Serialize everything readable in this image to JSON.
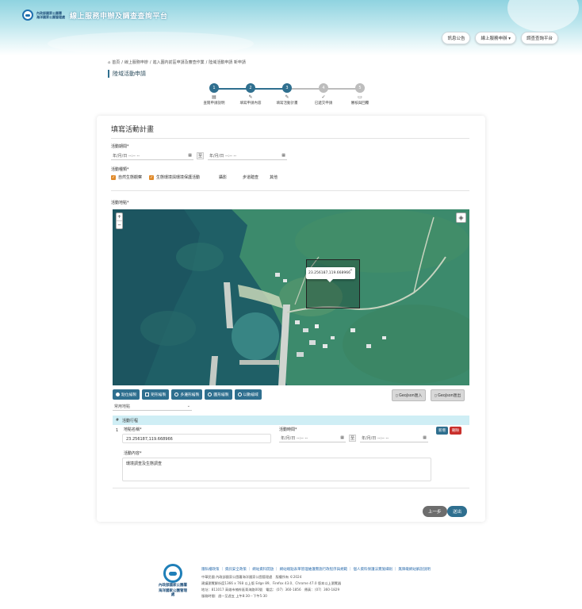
{
  "header": {
    "logo_org_line1": "內政部國家公園署",
    "logo_org_line2": "海洋國家公園管理處",
    "site_title": "線上服務申辦及調查查詢平台",
    "nav": [
      "訊息公告",
      "線上服務申辦 ▾",
      "調查查詢平台"
    ]
  },
  "breadcrumb": [
    "首頁",
    "線上服務申辦",
    "進入園內前區申請及審查作業",
    "陸域活動申請 新申請"
  ],
  "page_title": "陸域活動申請",
  "stepper": {
    "steps": [
      {
        "num": "1",
        "icon": "▤",
        "label": "查閱申請說明",
        "state": "done"
      },
      {
        "num": "2",
        "icon": "✎",
        "label": "填寫申請內容",
        "state": "done"
      },
      {
        "num": "3",
        "icon": "✎",
        "label": "填寫活動計畫",
        "state": "current"
      },
      {
        "num": "4",
        "icon": "✓",
        "label": "已遞交申請",
        "state": "pending"
      },
      {
        "num": "5",
        "icon": "▭",
        "label": "審核與回覆",
        "state": "pending"
      }
    ],
    "colors": {
      "done": "#2f6f8f",
      "pending": "#bdbdbd"
    }
  },
  "form": {
    "section_title": "填寫活動計畫",
    "period_label": "活動期間*",
    "date_placeholder": "年/月/日 --:-- --",
    "range_sep": "至",
    "type_label": "活動種類*",
    "types": [
      {
        "label": "自然生態觀察",
        "checked": true
      },
      {
        "label": "生態環境與環境保護活動",
        "checked": true
      },
      {
        "label": "攝影",
        "checked": false
      },
      {
        "label": "步道踏查",
        "checked": false
      },
      {
        "label": "其他",
        "checked": false
      }
    ],
    "map_label": "活動地點*",
    "map": {
      "popup_text": "23.256187,119.668966",
      "popup_close": "×",
      "zoom_in": "+",
      "zoom_out": "−"
    },
    "tools": [
      {
        "label": "點位繪製",
        "kind": "radio",
        "on": true
      },
      {
        "label": "矩形繪製",
        "kind": "square",
        "on": false
      },
      {
        "label": "多邊形繪製",
        "kind": "radio",
        "on": false
      },
      {
        "label": "圓形繪製",
        "kind": "radio",
        "on": false
      },
      {
        "label": "以數繪域",
        "kind": "radio",
        "on": false
      }
    ],
    "geojson_import": "GeoJson匯入",
    "geojson_export": "GeoJson匯出",
    "common_select": "常用地點",
    "table": {
      "col_index": "#",
      "col_itinerary": "活動行程",
      "row_index": "1",
      "place_label": "地點名稱*",
      "place_value": "23.256187,119.668966",
      "time_label": "活動時間*",
      "content_label": "活動內容*",
      "content_value": "環境調查及生態調查",
      "add_btn": "新增",
      "delete_btn": "刪除"
    },
    "prev_btn": "上一步",
    "next_btn": "送出"
  },
  "footer": {
    "org": [
      "內政部國家公園署",
      "海洋國家公園管理處"
    ],
    "links": [
      "隱私權政策",
      "資訊安全政策",
      "網站資料開放",
      "網站端點表單管理維護實施行政程序與規範",
      "個人資料保護法實施細則",
      "無障礙網站解說說明"
    ],
    "lines": [
      "中華民國 內政部國家公園署海洋國家公園管理處　版權所有 ©2024",
      "建議瀏覽解析度1366 x 768 以上版 Edge 89、Firefox 43.0、Chrome 47.0 版本以上瀏覽器",
      "地址：811017 高雄市楠梓區青海路00號　電話：（07）360-1856　傳真：（07）360-1829",
      "服務時間：週一至週五 上午8:30－下午5:30"
    ]
  },
  "colors": {
    "primary": "#2f6f8f",
    "checkbox": "#e08a2a",
    "add": "#2f6f8f",
    "delete": "#c9302c",
    "table_head": "#cfeef5"
  }
}
